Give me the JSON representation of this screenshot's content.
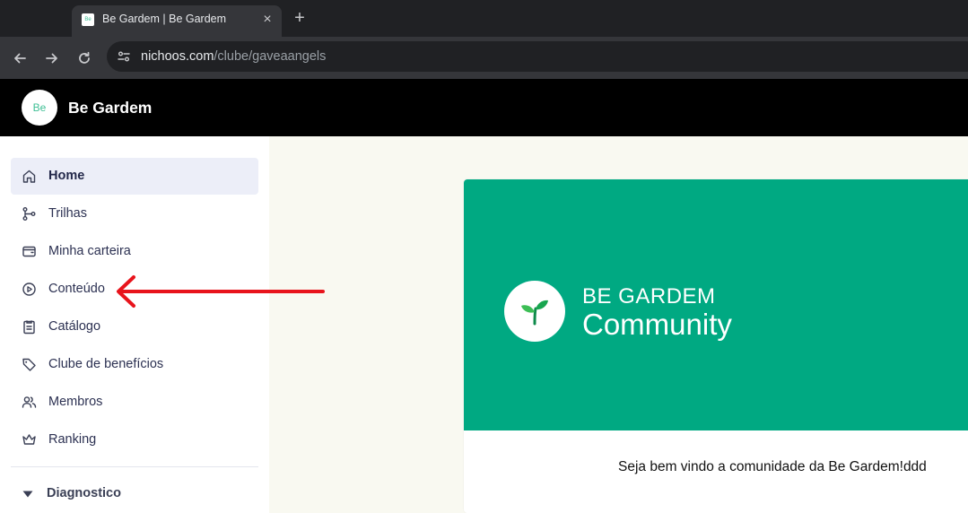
{
  "browser": {
    "tab": {
      "title": "Be Gardem | Be Gardem",
      "favicon_text": "Be"
    },
    "url_host": "nichoos.com",
    "url_path": "/clube/gaveaangels"
  },
  "app": {
    "logo_text": "Be",
    "title": "Be Gardem"
  },
  "sidebar": {
    "items": [
      {
        "label": "Home",
        "icon": "home-icon",
        "active": true
      },
      {
        "label": "Trilhas",
        "icon": "route-icon"
      },
      {
        "label": "Minha carteira",
        "icon": "wallet-icon"
      },
      {
        "label": "Conteúdo",
        "icon": "play-circle-icon"
      },
      {
        "label": "Catálogo",
        "icon": "clipboard-icon"
      },
      {
        "label": "Clube de benefícios",
        "icon": "tag-icon"
      },
      {
        "label": "Membros",
        "icon": "users-icon"
      },
      {
        "label": "Ranking",
        "icon": "crown-icon"
      }
    ],
    "section": {
      "label": "Diagnostico",
      "icon": "caret-down-icon"
    }
  },
  "main": {
    "banner": {
      "brand": "BE GARDEM",
      "subtitle": "Community",
      "logo_icon": "sprout-icon"
    },
    "welcome_text": "Seja bem vindo a comunidade da Be Gardem!ddd"
  },
  "colors": {
    "brand_green": "#00a982",
    "header_bg": "#000000",
    "active_item_bg": "#eceef8",
    "annotation_arrow": "#e8141c"
  }
}
